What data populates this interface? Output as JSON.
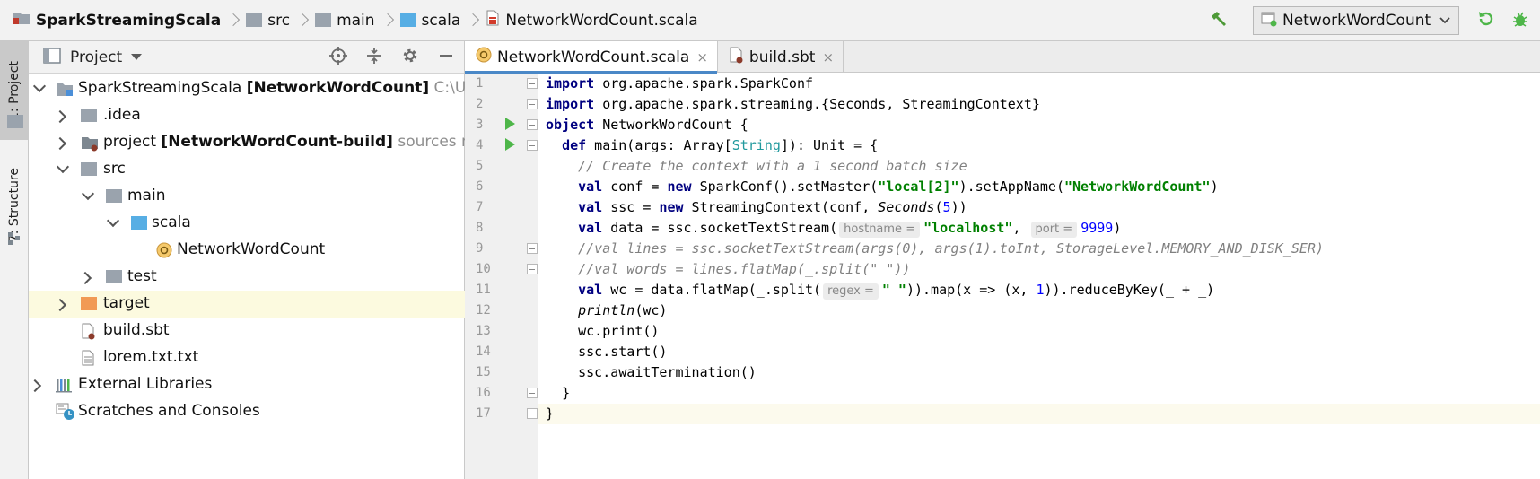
{
  "breadcrumbs": [
    {
      "label": "SparkStreamingScala",
      "icon": "project-folder-icon",
      "bold": true
    },
    {
      "label": "src",
      "icon": "folder-icon"
    },
    {
      "label": "main",
      "icon": "folder-icon"
    },
    {
      "label": "scala",
      "icon": "source-folder-icon"
    },
    {
      "label": "NetworkWordCount.scala",
      "icon": "scala-file-icon"
    }
  ],
  "toolbar": {
    "run_config_label": "NetworkWordCount",
    "build_icon": "hammer-icon",
    "rerun_icon": "rerun-icon",
    "debug_icon": "bug-icon"
  },
  "strip": {
    "project_tab": "1: Project",
    "structure_tab": "7: Structure"
  },
  "project_panel": {
    "title": "Project",
    "tree": [
      {
        "name": "SparkStreamingScala",
        "module": "[NetworkWordCount]",
        "extra": "C:\\User",
        "arrow": "down",
        "indent": 0,
        "icon": "module"
      },
      {
        "name": ".idea",
        "arrow": "right",
        "indent": 1,
        "icon": "folder"
      },
      {
        "name": "project",
        "module": "[NetworkWordCount-build]",
        "extra": "sources roo",
        "arrow": "right",
        "indent": 1,
        "icon": "folder-dark"
      },
      {
        "name": "src",
        "arrow": "down",
        "indent": 1,
        "icon": "folder"
      },
      {
        "name": "main",
        "arrow": "down",
        "indent": 2,
        "icon": "folder"
      },
      {
        "name": "scala",
        "arrow": "down",
        "indent": 3,
        "icon": "folder-blue"
      },
      {
        "name": "NetworkWordCount",
        "indent": 4,
        "icon": "object"
      },
      {
        "name": "test",
        "arrow": "right",
        "indent": 2,
        "icon": "folder"
      },
      {
        "name": "target",
        "arrow": "right",
        "indent": 1,
        "icon": "folder-orange",
        "highlight": true
      },
      {
        "name": "build.sbt",
        "indent": 1,
        "icon": "sbt"
      },
      {
        "name": "lorem.txt.txt",
        "indent": 1,
        "icon": "text"
      },
      {
        "name": "External Libraries",
        "arrow": "right",
        "indent": 0,
        "icon": "libraries"
      },
      {
        "name": "Scratches and Consoles",
        "indent": 0,
        "icon": "scratches"
      }
    ]
  },
  "editor": {
    "tabs": [
      {
        "label": "NetworkWordCount.scala",
        "active": true
      },
      {
        "label": "build.sbt",
        "active": false
      }
    ],
    "close_symbol": "×",
    "line_numbers": [
      "1",
      "2",
      "3",
      "4",
      "5",
      "6",
      "7",
      "8",
      "9",
      "10",
      "11",
      "12",
      "13",
      "14",
      "15",
      "16",
      "17"
    ],
    "code": {
      "l1_kw": "import",
      "l1_rest": " org.apache.spark.SparkConf",
      "l2_kw": "import",
      "l2_rest": " org.apache.spark.streaming.{Seconds, StreamingContext}",
      "l3_kw": "object",
      "l3_rest": " NetworkWordCount {",
      "l4_kw": "def",
      "l4_a": " main(args: Array[",
      "l4_type": "String",
      "l4_b": "]): Unit = {",
      "l5": "// Create the context with a 1 second batch size",
      "l6_kw1": "val",
      "l6_a": " conf = ",
      "l6_kw2": "new",
      "l6_b": " SparkConf().setMaster(",
      "l6_s1": "\"local[2]\"",
      "l6_c": ").setAppName(",
      "l6_s2": "\"NetworkWordCount\"",
      "l6_d": ")",
      "l7_kw1": "val",
      "l7_a": " ssc = ",
      "l7_kw2": "new",
      "l7_b": " StreamingContext(conf, ",
      "l7_it": "Seconds",
      "l7_c": "(",
      "l7_n": "5",
      "l7_d": "))",
      "l8_kw": "val",
      "l8_a": " data = ssc.socketTextStream(",
      "l8_h1": "hostname =",
      "l8_s": "\"localhost\"",
      "l8_b": ", ",
      "l8_h2": "port =",
      "l8_n": "9999",
      "l8_c": ")",
      "l9": "//val lines = ssc.socketTextStream(args(0), args(1).toInt, StorageLevel.MEMORY_AND_DISK_SER)",
      "l10": "//val words = lines.flatMap(_.split(\" \"))",
      "l11_kw": "val",
      "l11_a": " wc = data.flatMap(_.split(",
      "l11_h": "regex =",
      "l11_s": "\" \"",
      "l11_b": ")).map(x => (x, ",
      "l11_n": "1",
      "l11_c": ")).reduceByKey(_ + _)",
      "l12_it": "println",
      "l12_rest": "(wc)",
      "l13": "wc.print()",
      "l14": "ssc.start()",
      "l15": "ssc.awaitTermination()",
      "l16": "}",
      "l17": "}"
    }
  },
  "colors": {
    "keyword": "#000080",
    "string": "#008000",
    "comment": "#808080",
    "number": "#0000ff",
    "type": "#20999d",
    "run_gutter": "#4eb649"
  }
}
